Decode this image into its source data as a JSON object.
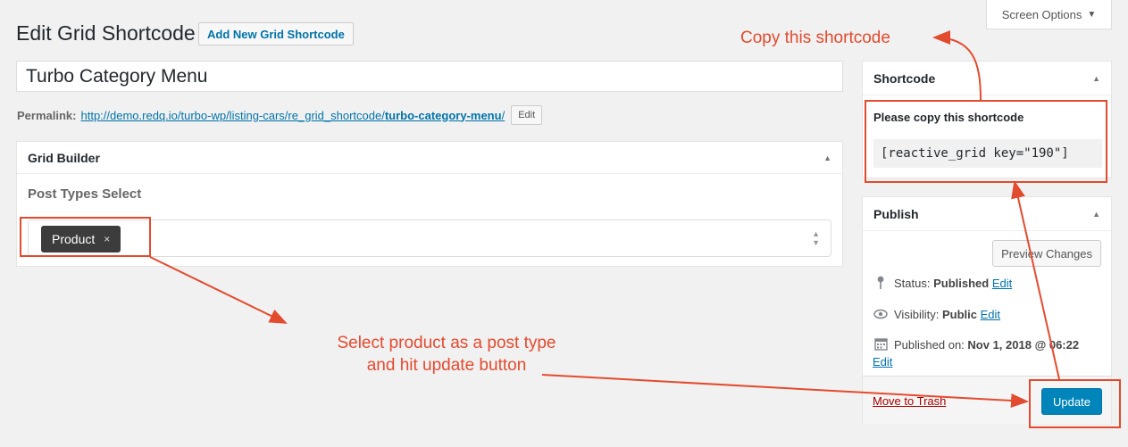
{
  "header": {
    "screen_options": "Screen Options",
    "screen_options_arrow": "▼",
    "page_title": "Edit Grid Shortcode",
    "add_new": "Add New Grid Shortcode"
  },
  "post": {
    "title": "Turbo Category Menu",
    "permalink_label": "Permalink:",
    "permalink_base": "http://demo.redq.io/turbo-wp/listing-cars/re_grid_shortcode/",
    "permalink_slug": "turbo-category-menu",
    "permalink_tail": "/",
    "edit_button": "Edit"
  },
  "grid_builder": {
    "title": "Grid Builder",
    "post_types_label": "Post Types Select",
    "selected_tag": "Product",
    "tag_remove": "×"
  },
  "shortcode_box": {
    "title": "Shortcode",
    "instruction": "Please copy this shortcode",
    "code": "[reactive_grid key=\"190\"]"
  },
  "publish_box": {
    "title": "Publish",
    "preview_button": "Preview Changes",
    "status_label": "Status:",
    "status_value": "Published",
    "visibility_label": "Visibility:",
    "visibility_value": "Public",
    "published_label": "Published on:",
    "published_value": "Nov 1, 2018 @ 06:22",
    "edit_link": "Edit",
    "trash_link": "Move to Trash",
    "update_button": "Update"
  },
  "annotations": {
    "copy_shortcode": "Copy this shortcode",
    "select_line1": "Select product as a post type",
    "select_line2": "and hit update button",
    "color": "#e34b2f"
  },
  "icons": {
    "collapse": "▲",
    "status_icon": "pin-icon",
    "visibility_icon": "eye-icon",
    "calendar_icon": "calendar-icon"
  }
}
